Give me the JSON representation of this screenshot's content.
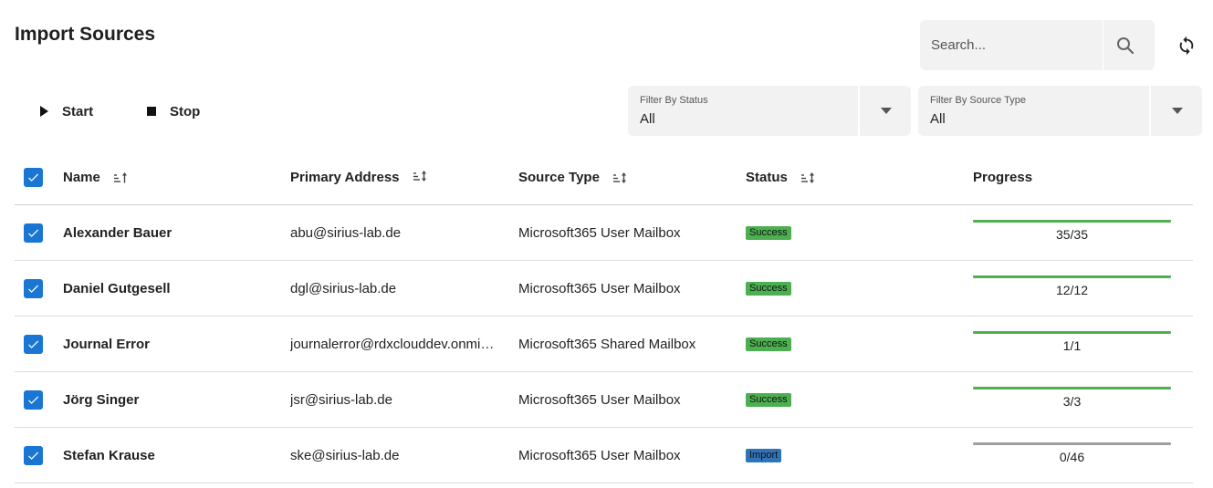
{
  "page": {
    "title": "Import Sources"
  },
  "search": {
    "placeholder": "Search...",
    "icon": "search-icon"
  },
  "refresh": {
    "icon": "refresh-icon"
  },
  "toolbar": {
    "start_label": "Start",
    "stop_label": "Stop"
  },
  "filters": {
    "status": {
      "label": "Filter By Status",
      "value": "All"
    },
    "source_type": {
      "label": "Filter By Source Type",
      "value": "All"
    }
  },
  "table": {
    "headers": {
      "name": "Name",
      "address": "Primary Address",
      "type": "Source Type",
      "status": "Status",
      "progress": "Progress"
    },
    "rows": [
      {
        "name": "Alexander Bauer",
        "address": "abu@sirius-lab.de",
        "type": "Microsoft365 User Mailbox",
        "status": "Success",
        "progress_text": "35/35",
        "progress": 1.0,
        "checked": true
      },
      {
        "name": "Daniel Gutgesell",
        "address": "dgl@sirius-lab.de",
        "type": "Microsoft365 User Mailbox",
        "status": "Success",
        "progress_text": "12/12",
        "progress": 1.0,
        "checked": true
      },
      {
        "name": "Journal Error",
        "address": "journalerror@rdxclouddev.onmi…",
        "type": "Microsoft365 Shared Mailbox",
        "status": "Success",
        "progress_text": "1/1",
        "progress": 1.0,
        "checked": true
      },
      {
        "name": "Jörg Singer",
        "address": "jsr@sirius-lab.de",
        "type": "Microsoft365 User Mailbox",
        "status": "Success",
        "progress_text": "3/3",
        "progress": 1.0,
        "checked": true
      },
      {
        "name": "Stefan Krause",
        "address": "ske@sirius-lab.de",
        "type": "Microsoft365 User Mailbox",
        "status": "Import",
        "progress_text": "0/46",
        "progress": 0.0,
        "checked": true
      }
    ]
  },
  "colors": {
    "accent": "#1976d2",
    "success": "#4caf50",
    "import": "#2f74b8",
    "track": "#9e9e9e"
  }
}
